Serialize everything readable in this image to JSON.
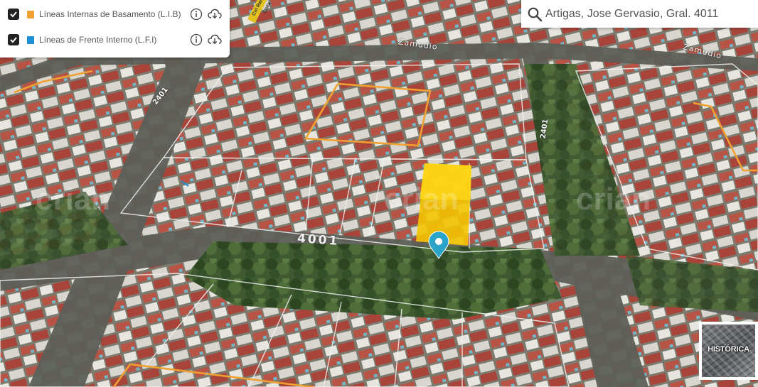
{
  "layers_panel": {
    "layers": [
      {
        "label": "Líneas Internas de Basamento (L.I.B)",
        "color": "#f0a030",
        "checked": true
      },
      {
        "label": "Líneas de Frente Interno (L.F.I)",
        "color": "#1f8fd6",
        "checked": true
      }
    ]
  },
  "search": {
    "value": "Artigas, Jose Gervasio, Gral. 4011"
  },
  "map": {
    "lot_number": "4001",
    "street_number_right": "2401",
    "street_number_left": "2401",
    "street_name_1": "Zamudio",
    "street_name_2": "Zamudio",
    "road_sign": "Cnl Ramón Lista",
    "watermark": "crian"
  },
  "historica": {
    "label": "HISTÓRICA"
  },
  "colors": {
    "lib_line": "#f0a030",
    "lfi_line": "#1f8fd6",
    "building_highlight": "#f4c400",
    "pin": "#2aa5c9"
  }
}
